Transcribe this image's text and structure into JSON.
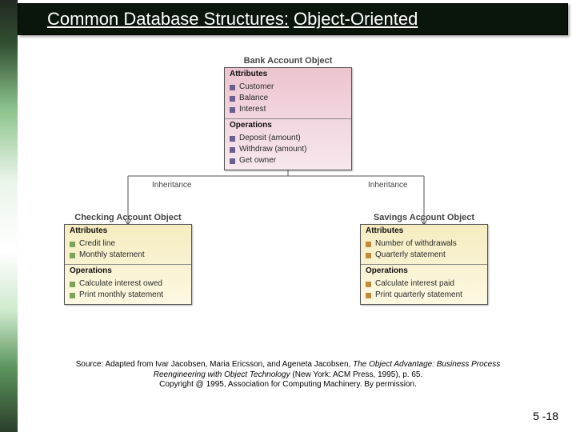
{
  "title": {
    "part1": "Common Database Structures:",
    "part2": "Object-Oriented"
  },
  "diagram": {
    "bank": {
      "label": "Bank Account Object",
      "attr_header": "Attributes",
      "attrs": [
        "Customer",
        "Balance",
        "Interest"
      ],
      "ops_header": "Operations",
      "ops": [
        "Deposit (amount)",
        "Withdraw (amount)",
        "Get owner"
      ]
    },
    "checking": {
      "label": "Checking Account Object",
      "attr_header": "Attributes",
      "attrs": [
        "Credit line",
        "Monthly statement"
      ],
      "ops_header": "Operations",
      "ops": [
        "Calculate interest owed",
        "Print monthly statement"
      ]
    },
    "savings": {
      "label": "Savings Account Object",
      "attr_header": "Attributes",
      "attrs": [
        "Number of withdrawals",
        "Quarterly statement"
      ],
      "ops_header": "Operations",
      "ops": [
        "Calculate interest paid",
        "Print quarterly statement"
      ]
    },
    "inheritance_label": "Inheritance"
  },
  "source": {
    "line1_pre": "Source: Adapted from Ivar Jacobsen, Maria Ericsson, and Ageneta Jacobsen, ",
    "line1_ital": "The Object Advantage: Business Process",
    "line2_ital": "Reengineering with Object Technology",
    "line2_post": " (New York: ACM Press, 1995), p. 65.",
    "line3": "Copyright @ 1995, Association for Computing Machinery. By permission."
  },
  "page": "5 -18"
}
